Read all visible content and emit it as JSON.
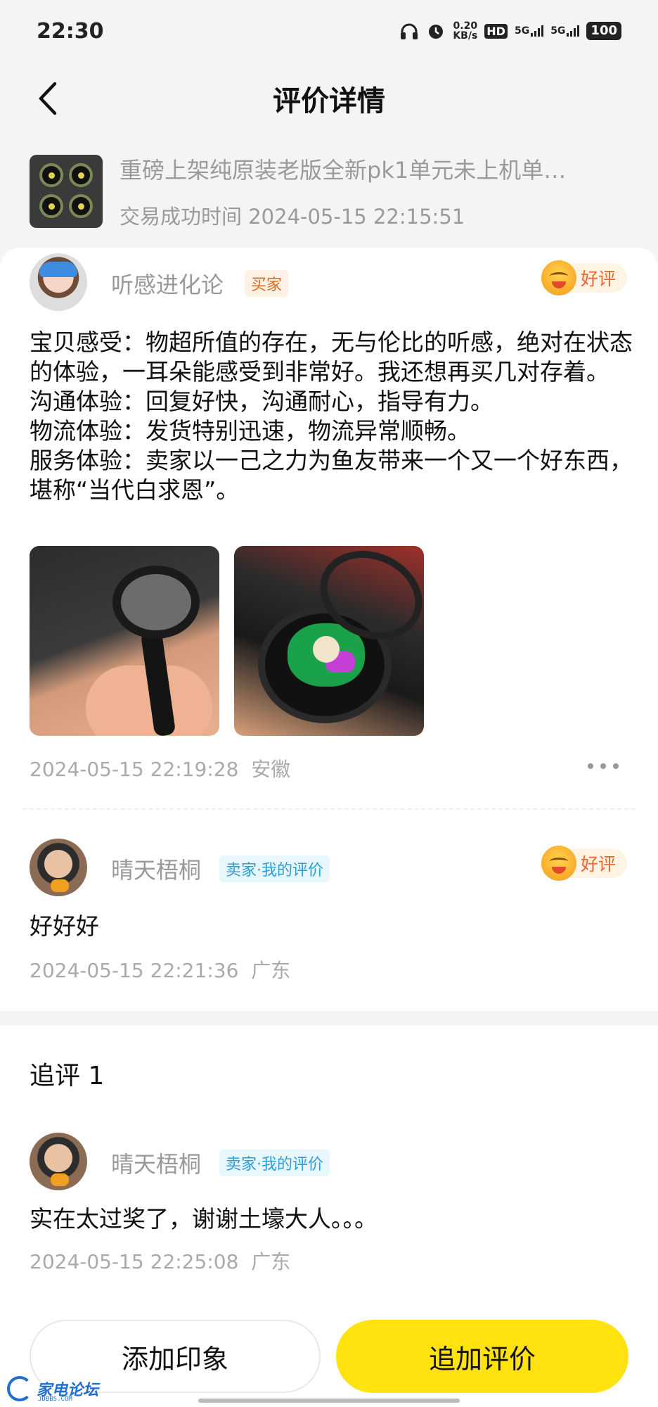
{
  "status_bar": {
    "time": "22:30",
    "net_speed_value": "0.20",
    "net_speed_unit": "KB/s",
    "hd_label": "HD",
    "signal_1_label": "5G",
    "signal_2_label": "5G",
    "battery": "100"
  },
  "header": {
    "title": "评价详情"
  },
  "product": {
    "title": "重磅上架纯原装老版全新pk1单元未上机单…",
    "trade_time": "交易成功时间 2024-05-15 22:15:51"
  },
  "review": {
    "user": "听感进化论",
    "role": "买家",
    "rating": "好评",
    "lines": [
      "宝贝感受：物超所值的存在，无与伦比的听感，绝对在状态的体验，一耳朵能感受到非常好。我还想再买几对存着。",
      "沟通体验：回复好快，沟通耐心，指导有力。",
      "物流体验：发货特别迅速，物流异常顺畅。",
      "服务体验：卖家以一己之力为鱼友带来一个又一个好东西，堪称“当代白求恩”。"
    ],
    "timestamp": "2024-05-15 22:19:28",
    "location": "安徽"
  },
  "seller_review": {
    "user": "晴天梧桐",
    "role": "卖家·我的评价",
    "rating": "好评",
    "text": "好好好",
    "timestamp": "2024-05-15 22:21:36",
    "location": "广东"
  },
  "follow_up": {
    "title": "追评 1",
    "user": "晴天梧桐",
    "role": "卖家·我的评价",
    "text": "实在太过奖了，谢谢土壕大人。。。",
    "timestamp": "2024-05-15 22:25:08",
    "location": "广东"
  },
  "actions": {
    "add_impression": "添加印象",
    "append_review": "追加评价"
  },
  "watermark": {
    "name": "家电论坛",
    "site": "JDBBS.COM"
  },
  "colors": {
    "accent_yellow": "#ffe20e",
    "good_rating": "#f2622a",
    "buyer_tag": "#e06a1c",
    "seller_tag": "#2a9fd6"
  }
}
